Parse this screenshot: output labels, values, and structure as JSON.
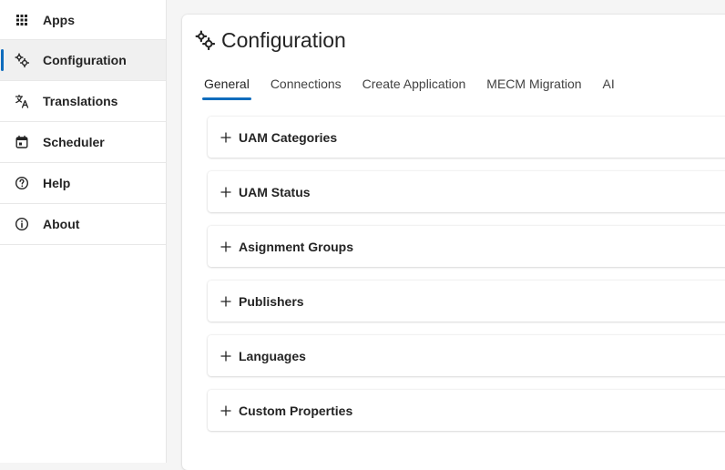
{
  "sidebar": {
    "items": [
      {
        "label": "Apps",
        "icon": "apps-grid-icon"
      },
      {
        "label": "Configuration",
        "icon": "gears-icon",
        "active": true
      },
      {
        "label": "Translations",
        "icon": "translate-icon"
      },
      {
        "label": "Scheduler",
        "icon": "calendar-icon"
      },
      {
        "label": "Help",
        "icon": "help-circle-icon"
      },
      {
        "label": "About",
        "icon": "info-circle-icon"
      }
    ]
  },
  "page": {
    "title": "Configuration",
    "icon": "gears-icon"
  },
  "tabs": [
    {
      "label": "General",
      "active": true
    },
    {
      "label": "Connections"
    },
    {
      "label": "Create Application"
    },
    {
      "label": "MECM Migration"
    },
    {
      "label": "AI"
    }
  ],
  "sections": [
    {
      "label": "UAM Categories"
    },
    {
      "label": "UAM Status"
    },
    {
      "label": "Asignment Groups"
    },
    {
      "label": "Publishers"
    },
    {
      "label": "Languages"
    },
    {
      "label": "Custom Properties"
    }
  ],
  "colors": {
    "accent": "#0f6cbd",
    "background": "#f5f5f5",
    "card": "#ffffff",
    "text": "#242424"
  }
}
